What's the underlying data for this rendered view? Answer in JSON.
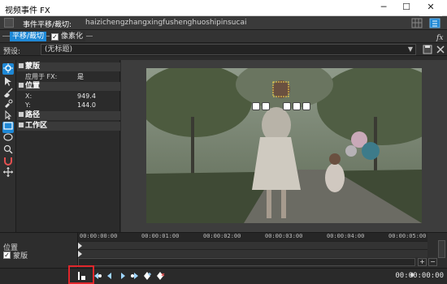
{
  "window": {
    "title": "视频事件 FX",
    "buttons": [
      "─",
      "☐",
      "✕"
    ]
  },
  "event": {
    "label": "事件平移/裁切:",
    "name": "haizichengzhangxingfushenghuoshipinsucai"
  },
  "chain": {
    "plugin_active": "平移/裁切",
    "plugin_second": "像素化",
    "plugin_second_checked": "✓"
  },
  "preset": {
    "label": "预设:",
    "value": "(无标题)",
    "dropdown_arrow": "▼"
  },
  "tools": [
    "gear-icon",
    "arrow-icon",
    "brush-icon",
    "brush2-icon",
    "pointer-icon",
    "rectangle-icon",
    "ellipse-icon",
    "zoom-icon",
    "magnet-icon",
    "move-icon"
  ],
  "props": {
    "mask_section": "蒙版",
    "apply_label": "应用于 FX:",
    "apply_value": "是",
    "position_section": "位置",
    "x_label": "X:",
    "x_value": "949.4",
    "y_label": "Y:",
    "y_value": "144.0",
    "path_section": "路径",
    "workspace_section": "工作区"
  },
  "timeline": {
    "track_position": "位置",
    "track_mask": "蒙版",
    "mask_checked": "✓",
    "ticks": [
      "00:00:00:00",
      "00:00:01:00",
      "00:00:02:00",
      "00:00:03:00",
      "00:00:04:00",
      "00:00:05:00"
    ],
    "zoom_in": "+",
    "zoom_out": "−"
  },
  "bottom": {
    "timecode": "00:00:00:00",
    "pin_icon": "♦",
    "keyframe_buttons": [
      "sync-cursor-icon",
      "first-keyframe-icon",
      "prev-keyframe-icon",
      "next-keyframe-icon",
      "last-keyframe-icon",
      "add-keyframe-icon",
      "delete-keyframe-icon"
    ]
  },
  "colors": {
    "accent": "#1e88d6",
    "highlight": "#e0262b",
    "bg": "#2b2b2b"
  }
}
